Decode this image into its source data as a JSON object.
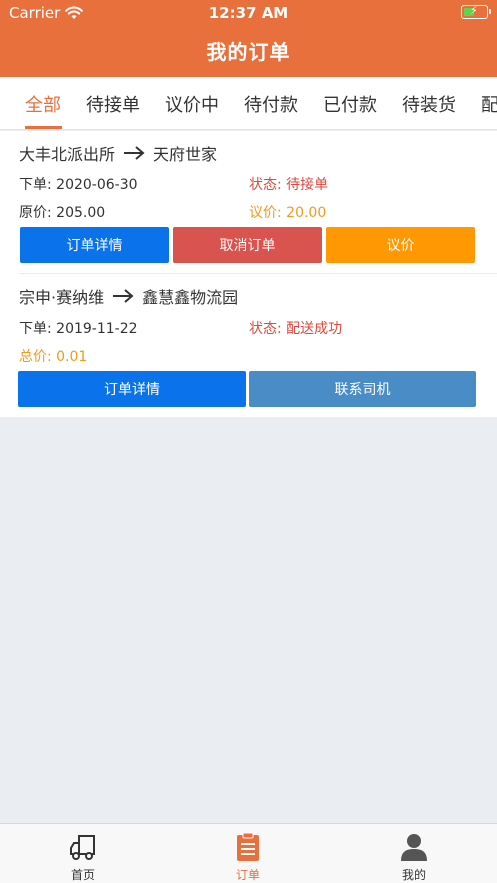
{
  "status_bar": {
    "carrier": "Carrier",
    "time": "12:37 AM"
  },
  "header": {
    "title": "我的订单"
  },
  "tabs": [
    {
      "label": "全部",
      "active": true
    },
    {
      "label": "待接单"
    },
    {
      "label": "议价中"
    },
    {
      "label": "待付款"
    },
    {
      "label": "已付款"
    },
    {
      "label": "待装货"
    },
    {
      "label": "配"
    }
  ],
  "orders": [
    {
      "from": "大丰北派出所",
      "to": "天府世家",
      "order_date_label": "下单:",
      "order_date": "2020-06-30",
      "status_label": "状态:",
      "status": "待接单",
      "price_label": "原价:",
      "price": "205.00",
      "bargain_label": "议价:",
      "bargain": "20.00",
      "buttons": [
        "订单详情",
        "取消订单",
        "议价"
      ]
    },
    {
      "from": "宗申·赛纳维",
      "to": "鑫慧鑫物流园",
      "order_date_label": "下单:",
      "order_date": "2019-11-22",
      "status_label": "状态:",
      "status": "配送成功",
      "total_label": "总价:",
      "total": "0.01",
      "buttons": [
        "订单详情",
        "联系司机"
      ]
    }
  ],
  "tabbar": [
    {
      "label": "首页",
      "icon": "truck-icon"
    },
    {
      "label": "订单",
      "icon": "clipboard-icon",
      "active": true
    },
    {
      "label": "我的",
      "icon": "person-icon"
    }
  ],
  "colors": {
    "accent": "#e8703c",
    "blue": "#0a73ec",
    "red": "#d9534f",
    "orange": "#ff9803",
    "steel": "#4a8cc5"
  }
}
